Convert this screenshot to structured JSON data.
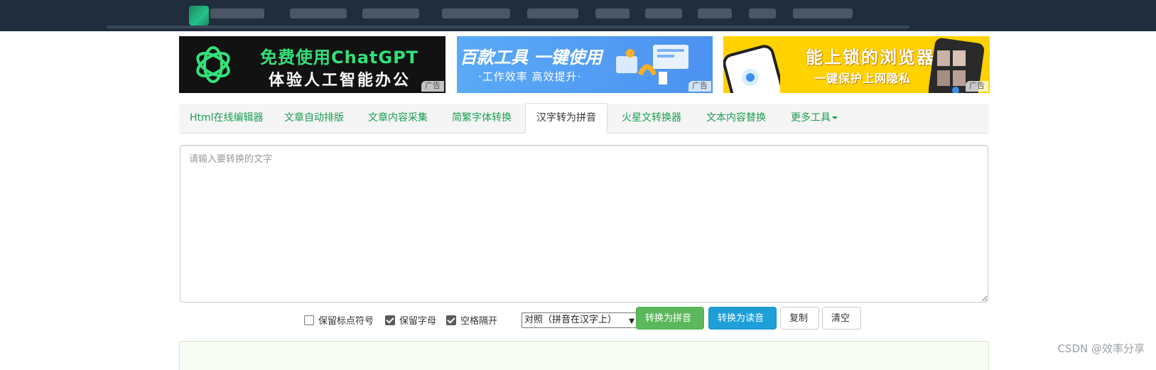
{
  "ads": [
    {
      "line1": "免费使用ChatGPT",
      "line2": "体验人工智能办公",
      "tag": "广告"
    },
    {
      "line1": "百款工具 一键使用",
      "line2": "·工作效率 高效提升·",
      "tag": "广告"
    },
    {
      "line1": "能上锁的浏览器",
      "line2": "一键保护上网隐私",
      "tag": "广告"
    }
  ],
  "tabs": [
    {
      "label": "Html在线编辑器",
      "active": false
    },
    {
      "label": "文章自动排版",
      "active": false
    },
    {
      "label": "文章内容采集",
      "active": false
    },
    {
      "label": "简繁字体转换",
      "active": false
    },
    {
      "label": "汉字转为拼音",
      "active": true
    },
    {
      "label": "火星文转换器",
      "active": false
    },
    {
      "label": "文本内容替换",
      "active": false
    },
    {
      "label": "更多工具",
      "active": false,
      "dropdown": true
    }
  ],
  "input": {
    "placeholder": "请输入要转换的文字",
    "value": ""
  },
  "options": {
    "keep_punctuation": {
      "label": "保留标点符号",
      "checked": false
    },
    "keep_letters": {
      "label": "保留字母",
      "checked": true
    },
    "space_separated": {
      "label": "空格隔开",
      "checked": true
    },
    "mode_selected": "对照（拼音在汉字上）"
  },
  "buttons": {
    "to_pinyin": "转换为拼音",
    "to_reading": "转换为读音",
    "copy": "复制",
    "clear": "清空"
  },
  "watermark": "CSDN @效率分享",
  "colors": {
    "topbar": "#1f2d3d",
    "tab_link": "#1a9e52",
    "btn_green": "#5cb85c",
    "btn_blue": "#1e9fd8"
  }
}
